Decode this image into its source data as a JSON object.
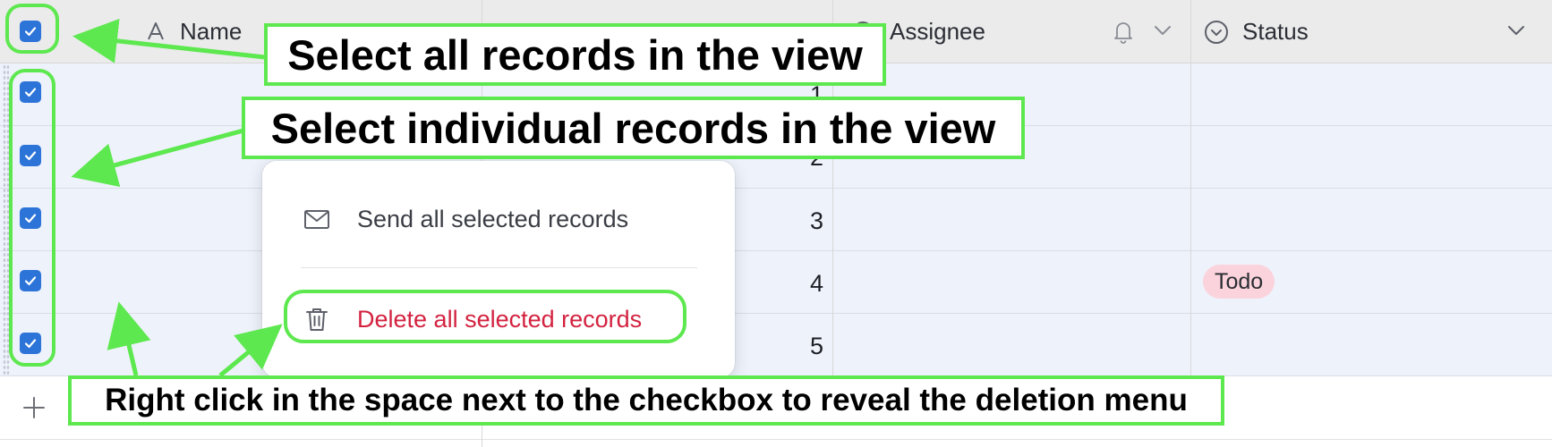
{
  "header": {
    "name_label": "Name",
    "assignee_label": "Assignee",
    "status_label": "Status"
  },
  "rows": [
    {
      "number": "1",
      "status": ""
    },
    {
      "number": "2",
      "status": ""
    },
    {
      "number": "3",
      "status": ""
    },
    {
      "number": "4",
      "status": "Todo"
    },
    {
      "number": "5",
      "status": ""
    }
  ],
  "add_row": {
    "icon": "plus-icon"
  },
  "context_menu": {
    "send_label": "Send all selected records",
    "delete_label": "Delete all selected records",
    "send_icon": "mail-icon",
    "delete_icon": "trash-icon"
  },
  "annotations": {
    "select_all": "Select all records in the view",
    "select_individual": "Select individual records in the view",
    "right_click": "Right click in the space next to the checkbox to reveal the deletion menu"
  },
  "colors": {
    "accent": "#2d74d8",
    "annotation_green": "#5ee84f",
    "delete_red": "#d3223f",
    "todo_pill": "#fbd3dc",
    "selected_row": "#eef2fb"
  }
}
